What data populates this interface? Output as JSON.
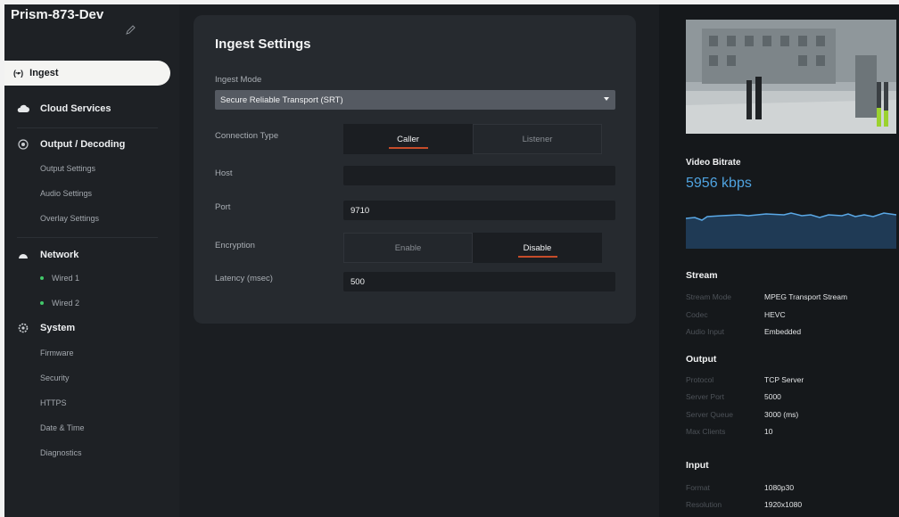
{
  "device": {
    "name": "Prism-873-Dev"
  },
  "sidebar": {
    "active": {
      "icon": "signal-icon",
      "label": "Ingest"
    },
    "cloud": {
      "label": "Cloud Services"
    },
    "output": {
      "label": "Output / Decoding",
      "items": [
        "Output Settings",
        "Audio Settings",
        "Overlay Settings"
      ]
    },
    "network": {
      "label": "Network",
      "items": [
        "Wired 1",
        "Wired 2"
      ]
    },
    "system": {
      "label": "System",
      "items": [
        "Firmware",
        "Security",
        "HTTPS",
        "Date & Time",
        "Diagnostics"
      ]
    }
  },
  "ingest": {
    "title": "Ingest Settings",
    "mode_label": "Ingest Mode",
    "mode_value": "Secure Reliable Transport (SRT)",
    "connection_label": "Connection Type",
    "connection_options": [
      "Caller",
      "Listener"
    ],
    "connection_selected": "Caller",
    "host_label": "Host",
    "host_value": "",
    "port_label": "Port",
    "port_value": "9710",
    "encryption_label": "Encryption",
    "encryption_options": [
      "Enable",
      "Disable"
    ],
    "encryption_selected": "Disable",
    "latency_label": "Latency (msec)",
    "latency_value": "500"
  },
  "monitor": {
    "bitrate_label": "Video Bitrate",
    "bitrate_value": "5956 kbps",
    "audio_levels": [
      0.42,
      0.36
    ],
    "stream": {
      "title": "Stream",
      "rows": [
        {
          "k": "Stream Mode",
          "v": "MPEG Transport Stream"
        },
        {
          "k": "Codec",
          "v": "HEVC"
        },
        {
          "k": "Audio Input",
          "v": "Embedded"
        }
      ]
    },
    "output": {
      "title": "Output",
      "rows": [
        {
          "k": "Protocol",
          "v": "TCP Server"
        },
        {
          "k": "Server Port",
          "v": "5000"
        },
        {
          "k": "Server Queue",
          "v": "3000 (ms)"
        },
        {
          "k": "Max Clients",
          "v": "10"
        }
      ]
    },
    "input": {
      "title": "Input",
      "rows": [
        {
          "k": "Format",
          "v": "1080p30"
        },
        {
          "k": "Resolution",
          "v": "1920x1080"
        }
      ]
    }
  },
  "colors": {
    "accent": "#c64c2a",
    "bitrate": "#4fa3e0",
    "status_ok": "#42c86a"
  }
}
